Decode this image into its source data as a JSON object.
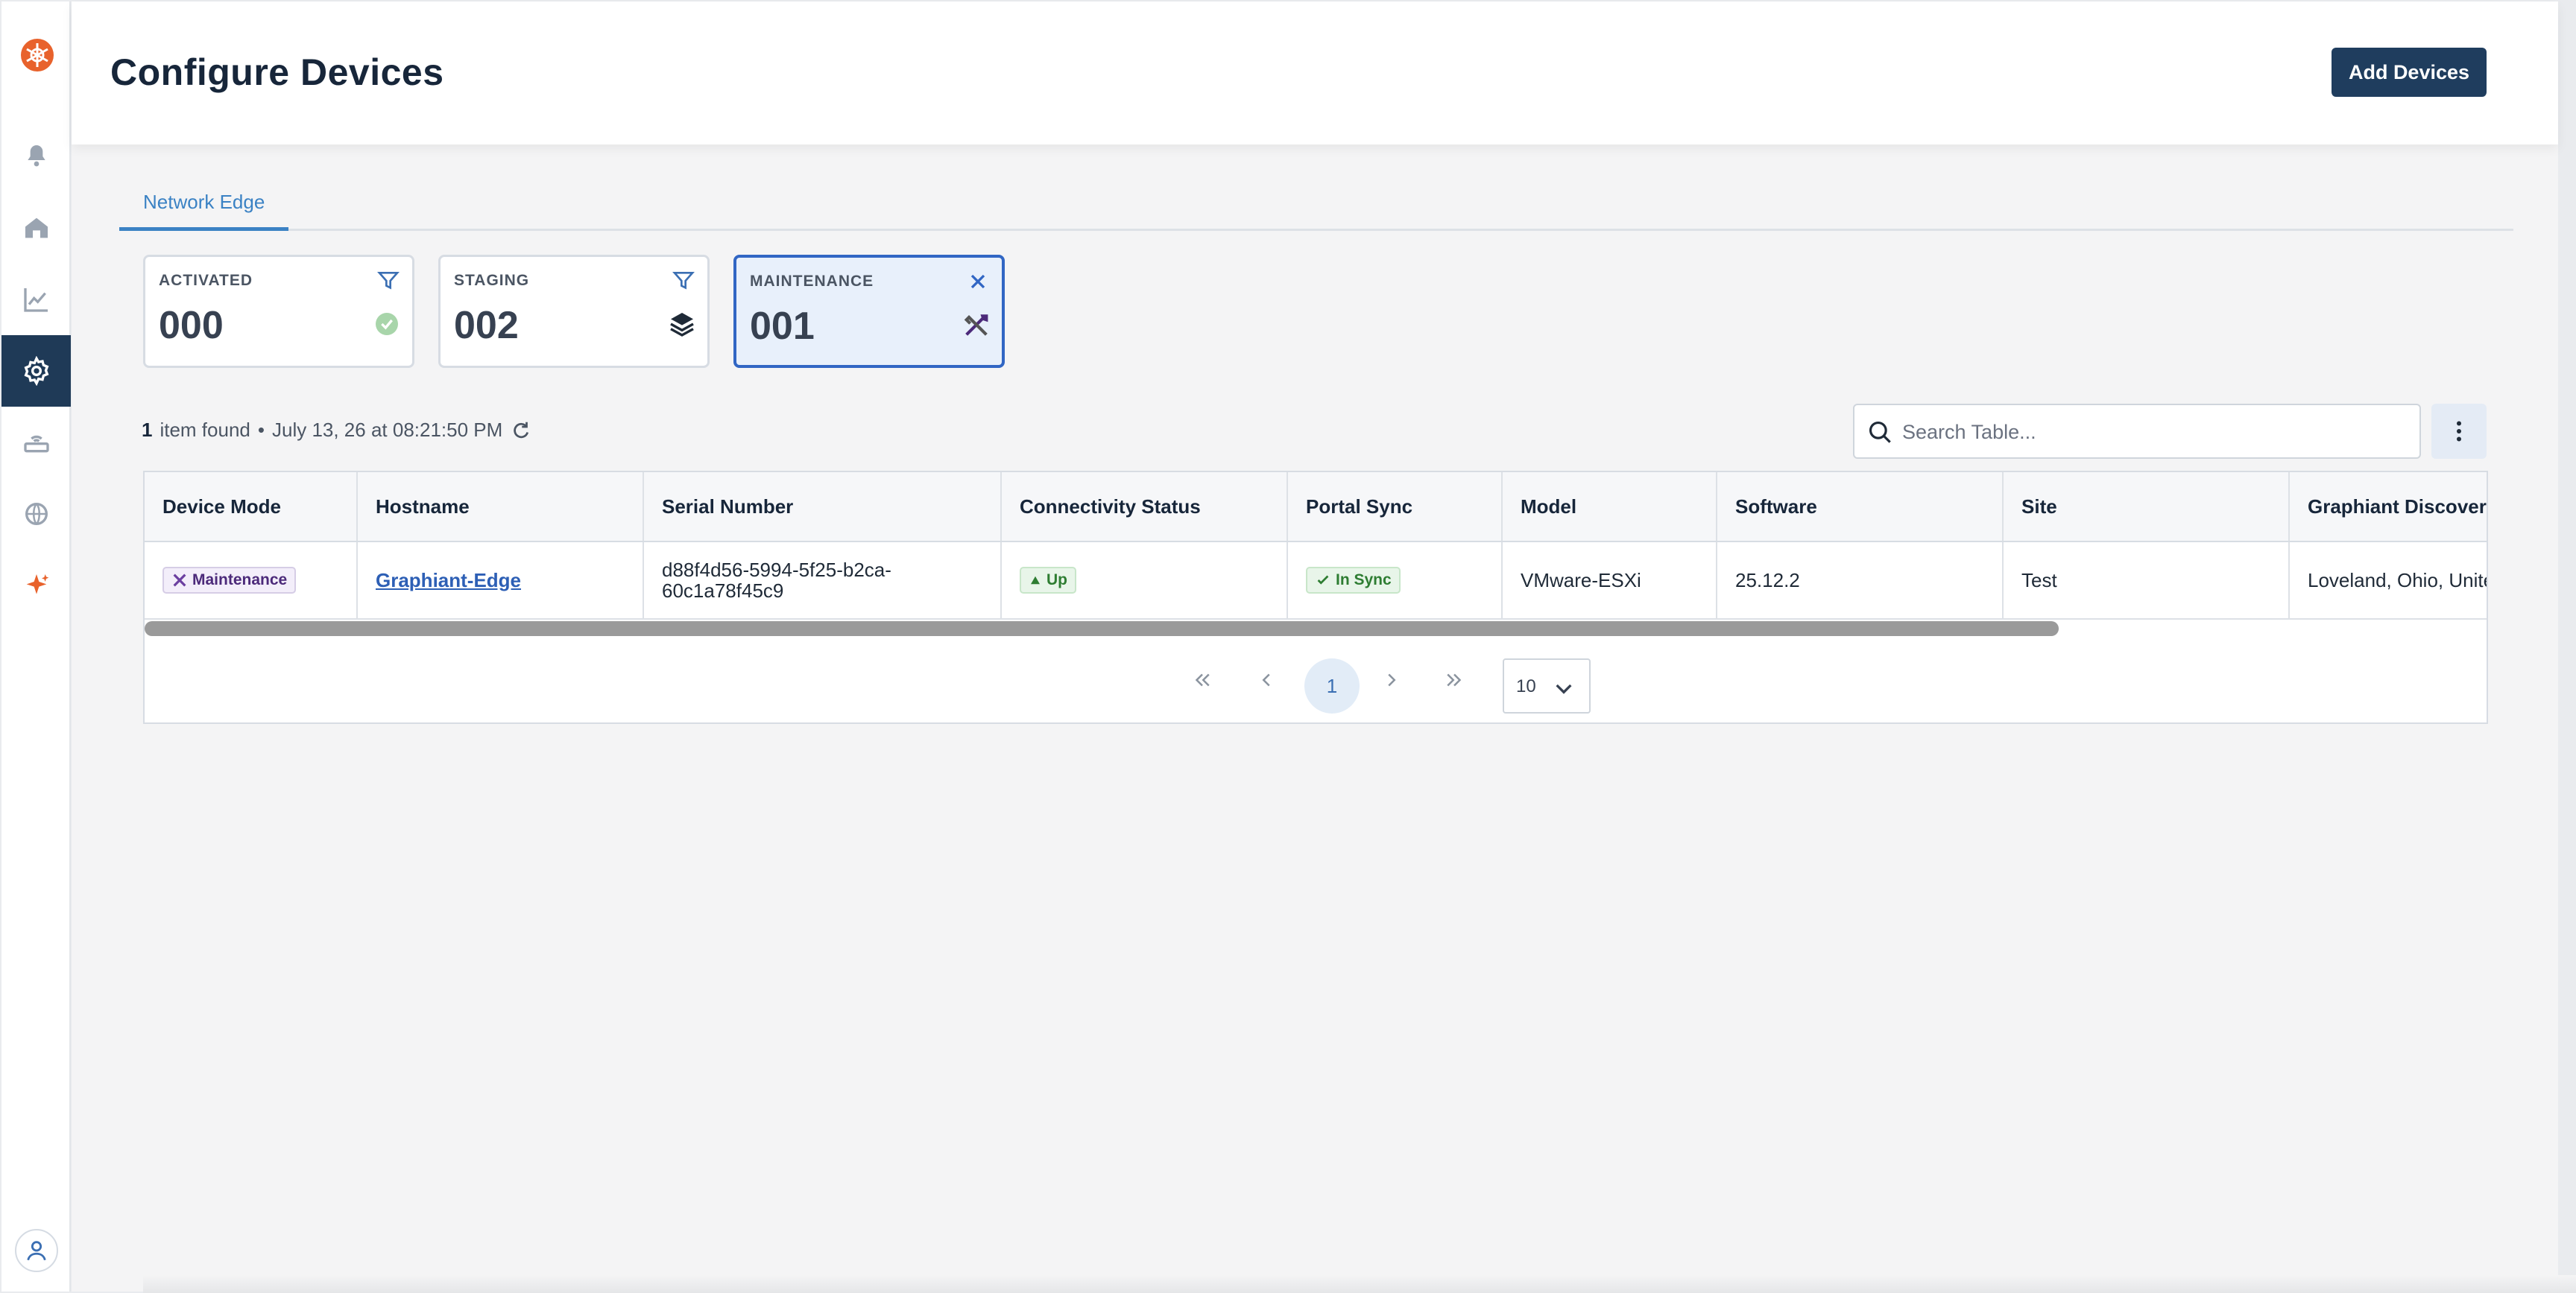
{
  "header": {
    "title": "Configure Devices",
    "add_button": "Add Devices"
  },
  "tabs": [
    {
      "label": "Network Edge",
      "active": true
    }
  ],
  "status_cards": [
    {
      "label": "ACTIVATED",
      "count": "000",
      "action_icon": "filter-icon",
      "status_icon": "check-circle-icon",
      "selected": false
    },
    {
      "label": "STAGING",
      "count": "002",
      "action_icon": "filter-icon",
      "status_icon": "layers-icon",
      "selected": false
    },
    {
      "label": "MAINTENANCE",
      "count": "001",
      "action_icon": "close-icon",
      "status_icon": "tools-icon",
      "selected": true
    }
  ],
  "results": {
    "count": "1",
    "label": "item found",
    "separator": "•",
    "timestamp": "July 13, 26 at 08:21:50 PM"
  },
  "search": {
    "placeholder": "Search Table..."
  },
  "table": {
    "columns": [
      "Device Mode",
      "Hostname",
      "Serial Number",
      "Connectivity Status",
      "Portal Sync",
      "Model",
      "Software",
      "Site",
      "Graphiant Discovered"
    ],
    "rows": [
      {
        "device_mode": "Maintenance",
        "hostname": "Graphiant-Edge",
        "serial": "d88f4d56-5994-5f25-b2ca-60c1a78f45c9",
        "connectivity": "Up",
        "portal_sync": "In Sync",
        "model": "VMware-ESXi",
        "software": "25.12.2",
        "site": "Test",
        "location": "Loveland, Ohio, United States"
      }
    ]
  },
  "pagination": {
    "current_page": "1",
    "page_size": "10"
  },
  "colors": {
    "accent": "#3b82c4",
    "primary_button": "#1f3d5e",
    "sidebar_active": "#1f3a57",
    "logo": "#e8622c"
  }
}
